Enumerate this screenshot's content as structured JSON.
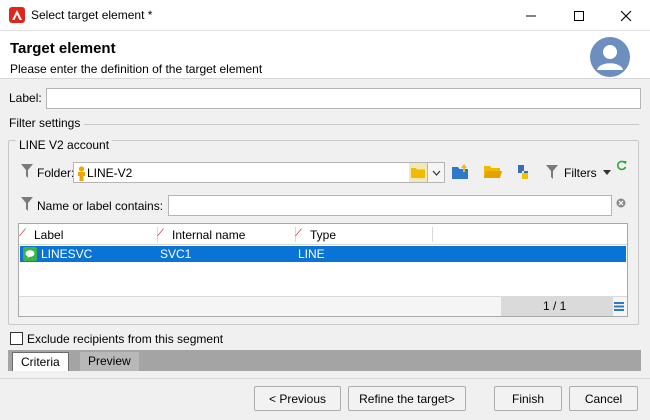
{
  "window": {
    "title": "Select target element *"
  },
  "header": {
    "title": "Target element",
    "subtitle": "Please enter the definition of the target element"
  },
  "form": {
    "label_caption": "Label:",
    "label_value": ""
  },
  "filter_settings": {
    "section_title": "Filter settings",
    "group_title": "LINE V2 account",
    "folder_caption": "Folder:",
    "folder_value": "LINE-V2",
    "filters_label": "Filters",
    "name_caption": "Name or label contains:",
    "name_value": ""
  },
  "grid": {
    "columns": [
      "Label",
      "Internal name",
      "Type"
    ],
    "rows": [
      {
        "label": "LINESVC",
        "internal_name": "SVC1",
        "type": "LINE"
      }
    ],
    "pager": "1 / 1"
  },
  "exclude": {
    "label": "Exclude recipients from this segment",
    "checked": false
  },
  "tabs": [
    "Criteria",
    "Preview"
  ],
  "buttons": {
    "previous": "< Previous",
    "refine": "Refine the target>",
    "finish": "Finish",
    "cancel": "Cancel"
  },
  "colors": {
    "selection": "#0a74d6",
    "app_red": "#e1251b",
    "folder_yellow": "#f5b800",
    "refresh_green": "#2eaa3a"
  }
}
